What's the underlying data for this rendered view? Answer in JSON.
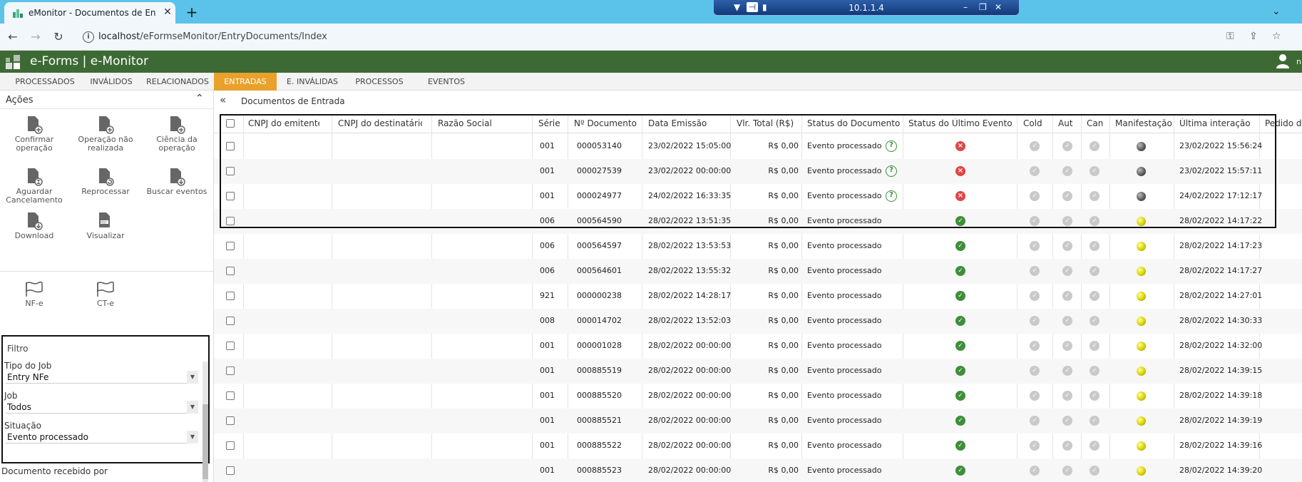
{
  "browser": {
    "tab_title": "eMonitor - Documentos de Entrada",
    "tab_close": "✕",
    "new_tab": "+",
    "rdp_host": "10.1.1.4",
    "url_host": "localhost",
    "url_path": "/eFormseMonitor/EntryDocuments/Index"
  },
  "app": {
    "title": "e-Forms | e-Monitor",
    "user_initial": "n"
  },
  "menu": [
    {
      "label": "PROCESSADOS"
    },
    {
      "label": "INVÁLIDOS"
    },
    {
      "label": "RELACIONADOS"
    },
    {
      "label": "ENTRADAS",
      "active": true
    },
    {
      "label": "E. INVÁLIDAS"
    },
    {
      "label": "PROCESSOS"
    },
    {
      "label": "EVENTOS"
    }
  ],
  "acoes": {
    "title": "Ações",
    "actions": [
      {
        "label": "Confirmar operação",
        "icon": "document-plus-icon"
      },
      {
        "label": "Operação não realizada",
        "icon": "document-plus-icon"
      },
      {
        "label": "Ciência da operação",
        "icon": "document-plus-icon"
      },
      {
        "label": "Aguardar Cancelamento",
        "icon": "document-hourglass-icon"
      },
      {
        "label": "Reprocessar",
        "icon": "document-refresh-icon"
      },
      {
        "label": "Buscar eventos",
        "icon": "document-download-icon"
      },
      {
        "label": "Download",
        "icon": "document-download-icon"
      },
      {
        "label": "Visualizar",
        "icon": "document-view-icon"
      }
    ],
    "doc_types": [
      {
        "label": "NF-e",
        "icon": "flag-icon"
      },
      {
        "label": "CT-e",
        "icon": "flag-icon"
      }
    ]
  },
  "filtro": {
    "title": "Filtro",
    "tipo_job_label": "Tipo do Job",
    "tipo_job_value": "Entry NFe",
    "job_label": "Job",
    "job_value": "Todos",
    "situacao_label": "Situação",
    "situacao_value": "Evento processado",
    "doc_recebido_label": "Documento recebido por"
  },
  "main": {
    "title": "Documentos de Entrada"
  },
  "table": {
    "columns": [
      "CNPJ do emitente",
      "CNPJ do destinatário",
      "Razão Social",
      "Série",
      "Nº Documento",
      "Data Emissão",
      "Vlr. Total (R$)",
      "Status do Documento",
      "Status do Último Evento",
      "Cold",
      "Aut",
      "Can",
      "Manifestação",
      "Última interação",
      "Pedido d"
    ],
    "rows": [
      {
        "serie": "001",
        "numero": "000053140",
        "emissao": "23/02/2022 15:05:00",
        "valor": "R$ 0,00",
        "status": "Evento processado",
        "help": true,
        "evento": "error",
        "manif": "grey",
        "ultima": "23/02/2022 15:56:24"
      },
      {
        "serie": "001",
        "numero": "000027539",
        "emissao": "23/02/2022 00:00:00",
        "valor": "R$ 0,00",
        "status": "Evento processado",
        "help": true,
        "evento": "error",
        "manif": "grey",
        "ultima": "23/02/2022 15:57:11"
      },
      {
        "serie": "001",
        "numero": "000024977",
        "emissao": "24/02/2022 16:33:35",
        "valor": "R$ 0,00",
        "status": "Evento processado",
        "help": true,
        "evento": "error",
        "manif": "grey",
        "ultima": "24/02/2022 17:12:17"
      },
      {
        "serie": "006",
        "numero": "000564590",
        "emissao": "28/02/2022 13:51:35",
        "valor": "R$ 0,00",
        "status": "Evento processado",
        "help": false,
        "evento": "ok",
        "manif": "yellow",
        "ultima": "28/02/2022 14:17:22"
      },
      {
        "serie": "006",
        "numero": "000564597",
        "emissao": "28/02/2022 13:53:53",
        "valor": "R$ 0,00",
        "status": "Evento processado",
        "help": false,
        "evento": "ok",
        "manif": "yellow",
        "ultima": "28/02/2022 14:17:23"
      },
      {
        "serie": "006",
        "numero": "000564601",
        "emissao": "28/02/2022 13:55:32",
        "valor": "R$ 0,00",
        "status": "Evento processado",
        "help": false,
        "evento": "ok",
        "manif": "yellow",
        "ultima": "28/02/2022 14:17:27"
      },
      {
        "serie": "921",
        "numero": "000000238",
        "emissao": "28/02/2022 14:28:17",
        "valor": "R$ 0,00",
        "status": "Evento processado",
        "help": false,
        "evento": "ok",
        "manif": "yellow",
        "ultima": "28/02/2022 14:27:01"
      },
      {
        "serie": "008",
        "numero": "000014702",
        "emissao": "28/02/2022 13:52:03",
        "valor": "R$ 0,00",
        "status": "Evento processado",
        "help": false,
        "evento": "ok",
        "manif": "yellow",
        "ultima": "28/02/2022 14:30:33"
      },
      {
        "serie": "001",
        "numero": "000001028",
        "emissao": "28/02/2022 00:00:00",
        "valor": "R$ 0,00",
        "status": "Evento processado",
        "help": false,
        "evento": "ok",
        "manif": "yellow",
        "ultima": "28/02/2022 14:32:00"
      },
      {
        "serie": "001",
        "numero": "000885519",
        "emissao": "28/02/2022 00:00:00",
        "valor": "R$ 0,00",
        "status": "Evento processado",
        "help": false,
        "evento": "ok",
        "manif": "yellow",
        "ultima": "28/02/2022 14:39:15"
      },
      {
        "serie": "001",
        "numero": "000885520",
        "emissao": "28/02/2022 00:00:00",
        "valor": "R$ 0,00",
        "status": "Evento processado",
        "help": false,
        "evento": "ok",
        "manif": "yellow",
        "ultima": "28/02/2022 14:39:18"
      },
      {
        "serie": "001",
        "numero": "000885521",
        "emissao": "28/02/2022 00:00:00",
        "valor": "R$ 0,00",
        "status": "Evento processado",
        "help": false,
        "evento": "ok",
        "manif": "yellow",
        "ultima": "28/02/2022 14:39:19"
      },
      {
        "serie": "001",
        "numero": "000885522",
        "emissao": "28/02/2022 00:00:00",
        "valor": "R$ 0,00",
        "status": "Evento processado",
        "help": false,
        "evento": "ok",
        "manif": "yellow",
        "ultima": "28/02/2022 14:39:16"
      },
      {
        "serie": "001",
        "numero": "000885523",
        "emissao": "28/02/2022 00:00:00",
        "valor": "R$ 0,00",
        "status": "Evento processado",
        "help": false,
        "evento": "ok",
        "manif": "yellow",
        "ultima": "28/02/2022 14:39:20"
      }
    ]
  },
  "colors": {
    "browser_tabbar": "#5bc3ea",
    "app_header": "#3d6a34",
    "menu_active": "#e8a12a",
    "status_error": "#e04545",
    "status_ok": "#3e8e3a",
    "manif_yellow": "#d8d200",
    "manif_grey": "#555555"
  }
}
